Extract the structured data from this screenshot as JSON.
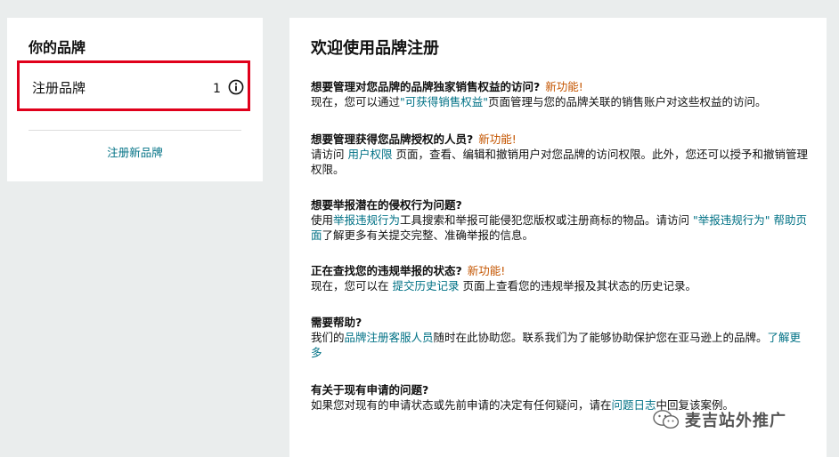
{
  "sidebar": {
    "title": "你的品牌",
    "brand_row": {
      "label": "注册品牌",
      "count": "1",
      "icon": "info-icon"
    },
    "register_new": "注册新品牌"
  },
  "main": {
    "title": "欢迎使用品牌注册",
    "new_badge": "新功能!",
    "sections": [
      {
        "heading": "想要管理对您品牌的品牌独家销售权益的访问?",
        "new": "新功能!",
        "parts": [
          {
            "t": "现在，您可以通过",
            "link": false
          },
          {
            "t": "\"可获得销售权益\"",
            "link": true
          },
          {
            "t": "页面管理与您的品牌关联的销售账户对这些权益的访问。",
            "link": false
          }
        ]
      },
      {
        "heading": "想要管理获得您品牌授权的人员?",
        "new": "新功能!",
        "parts": [
          {
            "t": "请访问 ",
            "link": false
          },
          {
            "t": "用户权限",
            "link": true
          },
          {
            "t": " 页面，查看、编辑和撤销用户对您品牌的访问权限。此外，您还可以授予和撤销管理权限。",
            "link": false
          }
        ]
      },
      {
        "heading": "想要举报潜在的侵权行为问题?",
        "new": "",
        "parts": [
          {
            "t": "使用",
            "link": false
          },
          {
            "t": "举报违规行为",
            "link": true
          },
          {
            "t": "工具搜索和举报可能侵犯您版权或注册商标的物品。请访问 ",
            "link": false
          },
          {
            "t": "\"举报违规行为\" 帮助页面",
            "link": true
          },
          {
            "t": "了解更多有关提交完整、准确举报的信息。",
            "link": false
          }
        ]
      },
      {
        "heading": "正在查找您的违规举报的状态?",
        "new": "新功能!",
        "parts": [
          {
            "t": "现在，您可以在 ",
            "link": false
          },
          {
            "t": "提交历史记录",
            "link": true
          },
          {
            "t": " 页面上查看您的违规举报及其状态的历史记录。",
            "link": false
          }
        ]
      },
      {
        "heading": "需要帮助?",
        "new": "",
        "parts": [
          {
            "t": "我们的",
            "link": false
          },
          {
            "t": "品牌注册客服人员",
            "link": true
          },
          {
            "t": "随时在此协助您。联系我们为了能够协助保护您在亚马逊上的品牌。",
            "link": false
          },
          {
            "t": "了解更多",
            "link": true
          }
        ]
      },
      {
        "heading": "有关于现有申请的问题?",
        "new": "",
        "parts": [
          {
            "t": "如果您对现有的申请状态或先前申请的决定有任何疑问，请在",
            "link": false
          },
          {
            "t": "问题日志",
            "link": true
          },
          {
            "t": "中回复该案例。",
            "link": false
          }
        ]
      }
    ]
  },
  "watermark": {
    "text": "麦吉站外推广",
    "icon": "wechat-icon"
  },
  "colors": {
    "link": "#007185",
    "new": "#c45500",
    "highlight": "#e0001b",
    "background": "#eaeded"
  }
}
